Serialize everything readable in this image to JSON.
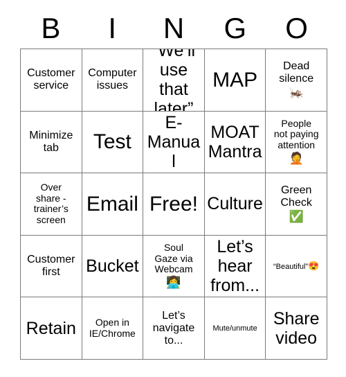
{
  "card": {
    "title": "BINGO",
    "header_letters": [
      "B",
      "I",
      "N",
      "G",
      "O"
    ],
    "rows": [
      [
        {
          "text": "Customer\nservice",
          "size": "md",
          "emoji": ""
        },
        {
          "text": "Computer\nissues",
          "size": "md",
          "emoji": ""
        },
        {
          "text": "“We’ll\nuse that\nlater”",
          "size": "lg",
          "emoji": ""
        },
        {
          "text": "MAP",
          "size": "xl",
          "emoji": ""
        },
        {
          "text": "Dead\nsilence",
          "size": "md",
          "emoji": "🦗"
        }
      ],
      [
        {
          "text": "Minimize\ntab",
          "size": "md",
          "emoji": ""
        },
        {
          "text": "Test",
          "size": "xl",
          "emoji": ""
        },
        {
          "text": "E-\nManual",
          "size": "lg",
          "emoji": ""
        },
        {
          "text": "MOAT\nMantra",
          "size": "lg",
          "emoji": ""
        },
        {
          "text": "People\nnot paying\nattention",
          "size": "sm",
          "emoji": "🤦"
        }
      ],
      [
        {
          "text": "Over\nshare -\ntrainer’s\nscreen",
          "size": "sm",
          "emoji": ""
        },
        {
          "text": "Email",
          "size": "xl",
          "emoji": ""
        },
        {
          "text": "Free!",
          "size": "xl",
          "emoji": ""
        },
        {
          "text": "Culture",
          "size": "lg",
          "emoji": ""
        },
        {
          "text": "Green\nCheck",
          "size": "md",
          "emoji": "✅"
        }
      ],
      [
        {
          "text": "Customer\nfirst",
          "size": "md",
          "emoji": ""
        },
        {
          "text": "Bucket",
          "size": "lg",
          "emoji": ""
        },
        {
          "text": "Soul\nGaze via\nWebcam",
          "size": "sm",
          "emoji": "👩‍💻"
        },
        {
          "text": "Let’s\nhear\nfrom...",
          "size": "lg",
          "emoji": ""
        },
        {
          "text": "“Beautiful”",
          "size": "xs",
          "emoji_inline": "😍"
        }
      ],
      [
        {
          "text": "Retain",
          "size": "lg",
          "emoji": ""
        },
        {
          "text": "Open in\nIE/Chrome",
          "size": "sm",
          "emoji": ""
        },
        {
          "text": "Let’s\nnavigate\nto...",
          "size": "md",
          "emoji": ""
        },
        {
          "text": "Mute/unmute",
          "size": "xs",
          "emoji": ""
        },
        {
          "text": "Share\nvideo",
          "size": "lg",
          "emoji": ""
        }
      ]
    ]
  },
  "colors": {
    "background": "#ffffff",
    "text": "#000000",
    "grid_line": "#7a7a7a"
  }
}
